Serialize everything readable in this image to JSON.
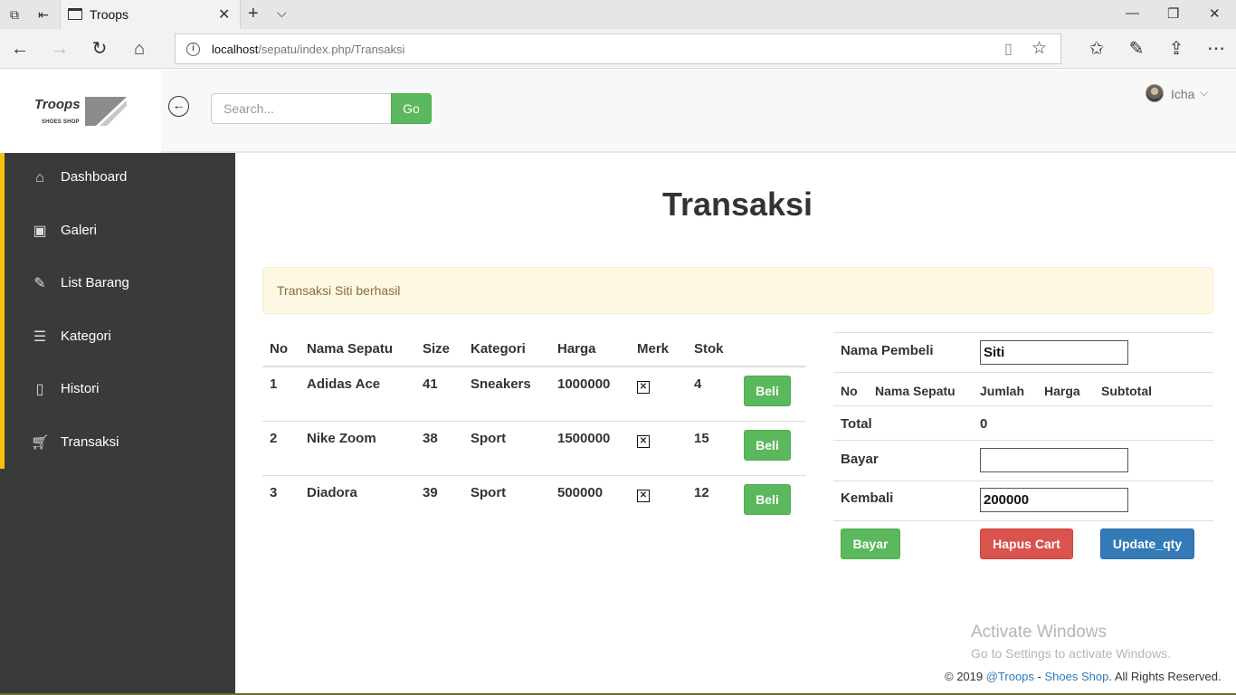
{
  "browser": {
    "tab_title": "Troops",
    "url_host": "localhost",
    "url_path": "/sepatu/index.php/Transaksi"
  },
  "header": {
    "logo_text": "Troops",
    "logo_sub": "SHOES SHOP",
    "search_placeholder": "Search...",
    "go_label": "Go",
    "user_name": "Icha"
  },
  "sidebar": {
    "items": [
      {
        "label": "Dashboard",
        "icon": "home-icon"
      },
      {
        "label": "Galeri",
        "icon": "image-icon"
      },
      {
        "label": "List Barang",
        "icon": "pencil-icon"
      },
      {
        "label": "Kategori",
        "icon": "list-icon"
      },
      {
        "label": "Histori",
        "icon": "book-icon"
      },
      {
        "label": "Transaksi",
        "icon": "cart-icon"
      }
    ]
  },
  "main": {
    "title": "Transaksi",
    "alert": "Transaksi Siti berhasil",
    "table": {
      "headers": [
        "No",
        "Nama Sepatu",
        "Size",
        "Kategori",
        "Harga",
        "Merk",
        "Stok",
        ""
      ],
      "rows": [
        {
          "no": "1",
          "nama": "Adidas Ace",
          "size": "41",
          "kategori": "Sneakers",
          "harga": "1000000",
          "stok": "4",
          "button": "Beli"
        },
        {
          "no": "2",
          "nama": "Nike Zoom",
          "size": "38",
          "kategori": "Sport",
          "harga": "1500000",
          "stok": "15",
          "button": "Beli"
        },
        {
          "no": "3",
          "nama": "Diadora",
          "size": "39",
          "kategori": "Sport",
          "harga": "500000",
          "stok": "12",
          "button": "Beli"
        }
      ]
    },
    "cart": {
      "nama_pembeli_label": "Nama Pembeli",
      "nama_pembeli_value": "Siti",
      "headers": [
        "No",
        "Nama Sepatu",
        "Jumlah",
        "Harga",
        "Subtotal"
      ],
      "total_label": "Total",
      "total_value": "0",
      "bayar_label": "Bayar",
      "bayar_value": "",
      "kembali_label": "Kembali",
      "kembali_value": "200000",
      "btn_bayar": "Bayar",
      "btn_hapus": "Hapus Cart",
      "btn_update": "Update_qty"
    },
    "watermark_line1": "Activate Windows",
    "watermark_line2": "Go to Settings to activate Windows.",
    "footer": {
      "prefix": "© 2019 ",
      "link1": "@Troops",
      "sep": " - ",
      "link2": "Shoes Shop",
      "suffix": ". All Rights Reserved."
    }
  },
  "colors": {
    "sidebar_bg": "#3a3a3a",
    "sidebar_accent": "#f4c20d",
    "success": "#5cb85c",
    "danger": "#d9534f",
    "primary": "#337ab7",
    "alert_bg": "#fcf8e3"
  }
}
